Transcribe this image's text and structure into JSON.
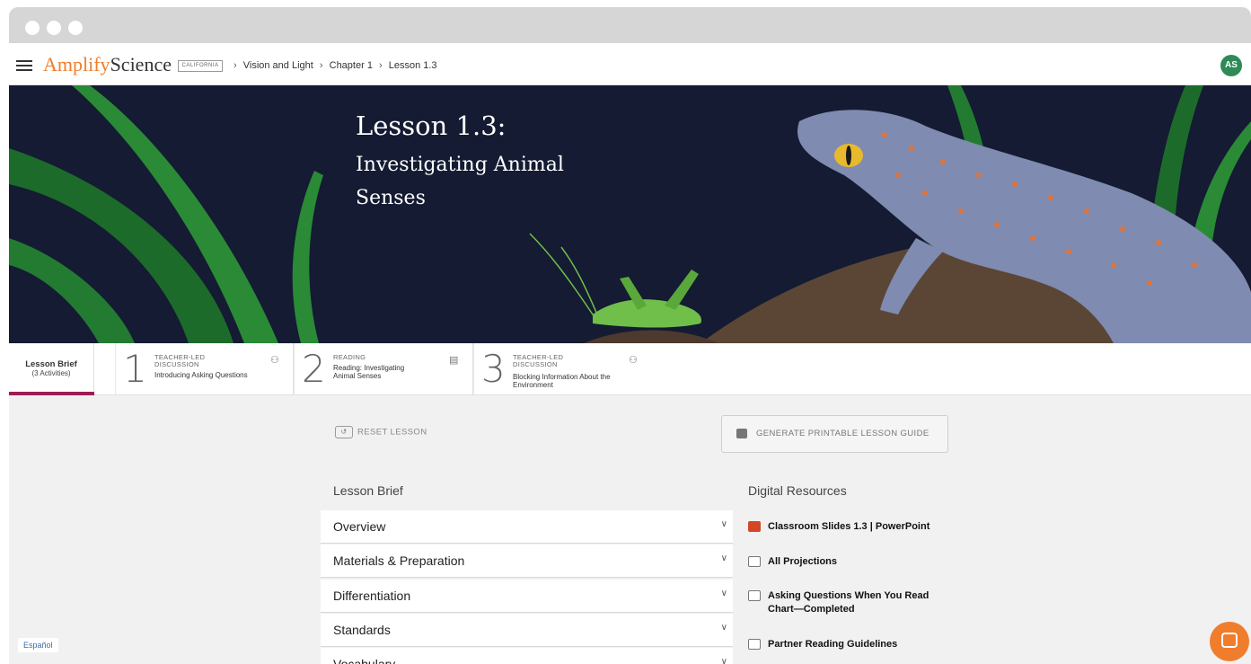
{
  "app": {
    "brand_first": "Amplify",
    "brand_second": "Science",
    "state_badge": "CALIFORNIA",
    "breadcrumbs": [
      "Vision and Light",
      "Chapter 1",
      "Lesson 1.3"
    ],
    "avatar_initials": "AS"
  },
  "hero": {
    "title": "Lesson 1.3:",
    "subtitle": "Investigating Animal Senses"
  },
  "tabs": {
    "brief_label": "Lesson Brief",
    "brief_sub": "(3 Activities)",
    "activities": [
      {
        "number": "1",
        "type": "TEACHER-LED DISCUSSION",
        "title": "Introducing Asking Questions",
        "icon": "teacher-icon"
      },
      {
        "number": "2",
        "type": "READING",
        "title": "Reading: Investigating Animal Senses",
        "icon": "reading-icon"
      },
      {
        "number": "3",
        "type": "TEACHER-LED DISCUSSION",
        "title": "Blocking Information About the Environment",
        "icon": "teacher-icon"
      }
    ]
  },
  "actions": {
    "reset": "RESET LESSON",
    "generate": "GENERATE PRINTABLE LESSON GUIDE"
  },
  "lesson_brief": {
    "heading": "Lesson Brief",
    "items": [
      "Overview",
      "Materials & Preparation",
      "Differentiation",
      "Standards",
      "Vocabulary"
    ]
  },
  "digital_resources": {
    "heading": "Digital Resources",
    "items": [
      {
        "label": "Classroom Slides 1.3 | PowerPoint",
        "icon": "powerpoint-icon"
      },
      {
        "label": "All Projections",
        "icon": "projection-icon"
      },
      {
        "label": "Asking Questions When You Read Chart—Completed",
        "icon": "print-icon"
      },
      {
        "label": "Partner Reading Guidelines",
        "icon": "image-icon"
      }
    ]
  },
  "footer": {
    "language": "Español"
  },
  "colors": {
    "brand_orange": "#f07d2c",
    "tab_accent": "#9e1d53",
    "hero_bg": "#141b32",
    "avatar_green": "#2e8b57"
  }
}
